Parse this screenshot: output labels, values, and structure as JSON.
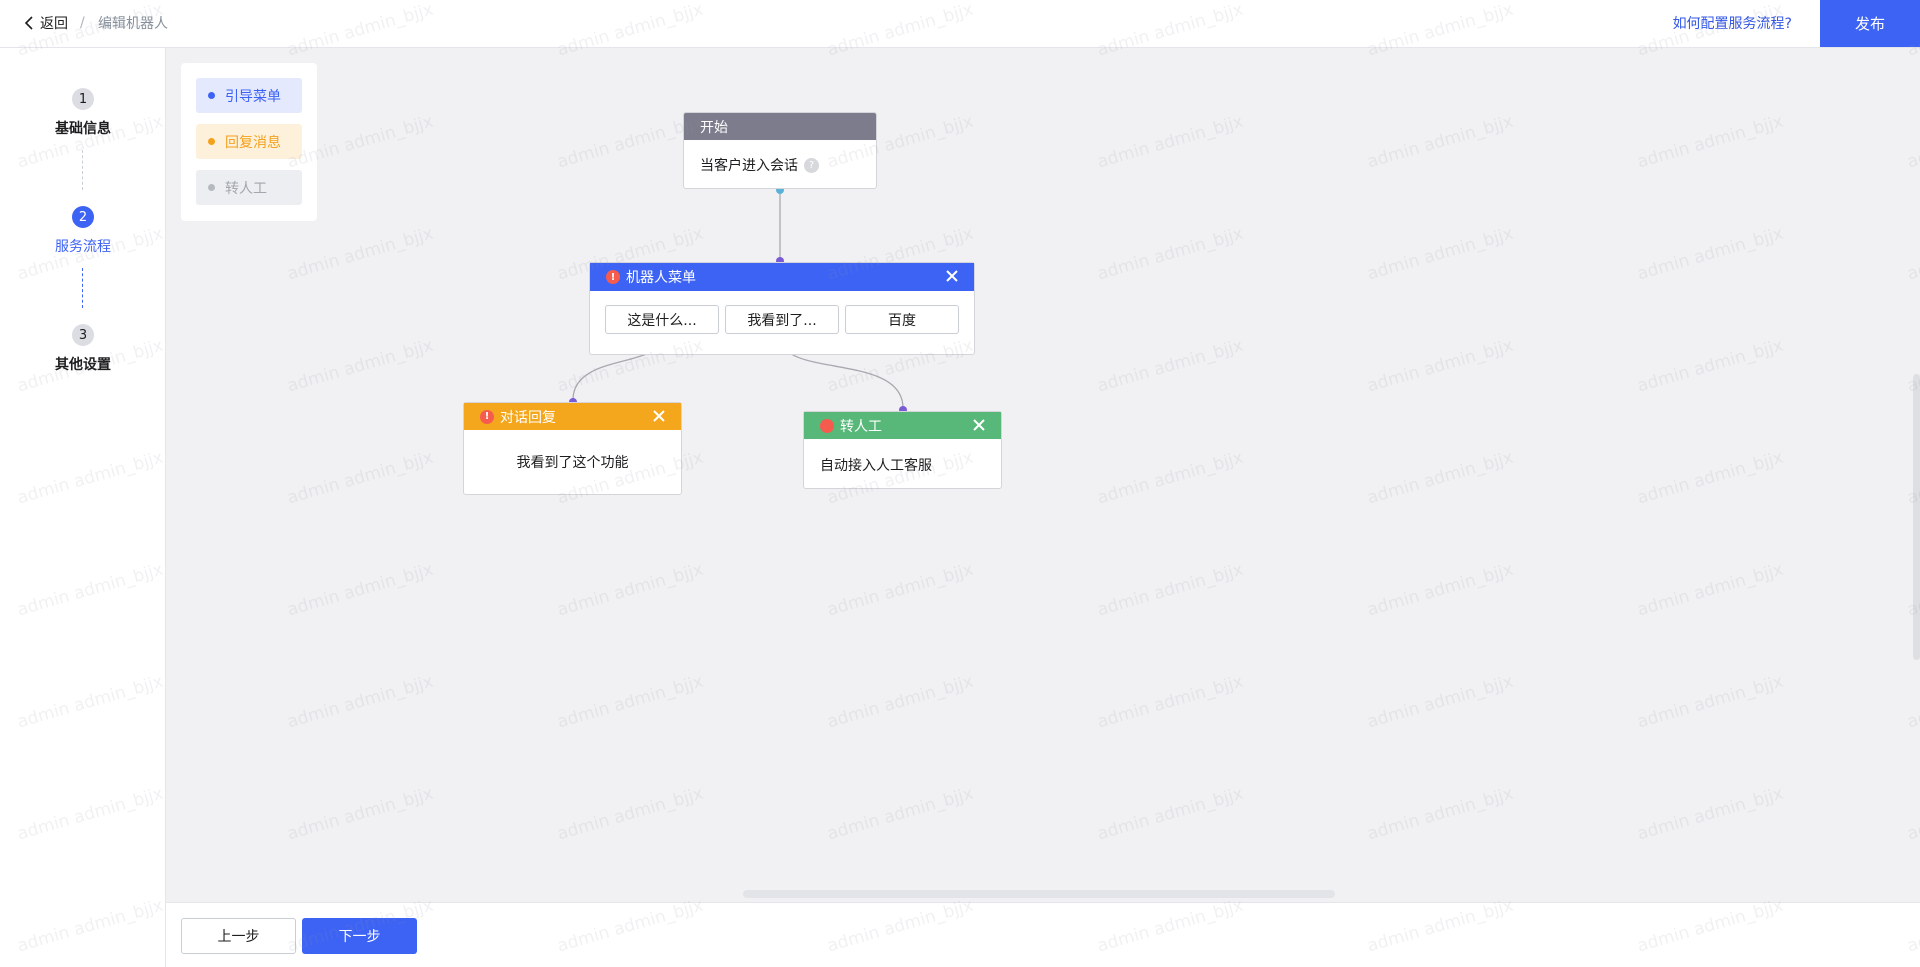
{
  "header": {
    "back_label": "返回",
    "separator": "/",
    "breadcrumb_current": "编辑机器人",
    "help_link": "如何配置服务流程?",
    "publish_label": "发布"
  },
  "steps": [
    {
      "num": "1",
      "label": "基础信息"
    },
    {
      "num": "2",
      "label": "服务流程"
    },
    {
      "num": "3",
      "label": "其他设置"
    }
  ],
  "palette": {
    "items": [
      "引导菜单",
      "回复消息",
      "转人工"
    ]
  },
  "flow": {
    "start": {
      "title": "开始",
      "body": "当客户进入会话",
      "help": "?"
    },
    "menu": {
      "title": "机器人菜单",
      "options": [
        "这是什么...",
        "我看到了...",
        "百度"
      ]
    },
    "reply": {
      "title": "对话回复",
      "body": "我看到了这个功能"
    },
    "human": {
      "title": "转人工",
      "body": "自动接入人工客服"
    }
  },
  "footer": {
    "prev_label": "上一步",
    "next_label": "下一步"
  },
  "watermark": "admin admin_bjjx",
  "colors": {
    "primary": "#3d63f5",
    "start_header": "#7c7c8c",
    "reply_header": "#f4a71d",
    "human_header": "#57b87a",
    "error": "#f55c4e",
    "canvas_bg": "#f1f1f3"
  }
}
